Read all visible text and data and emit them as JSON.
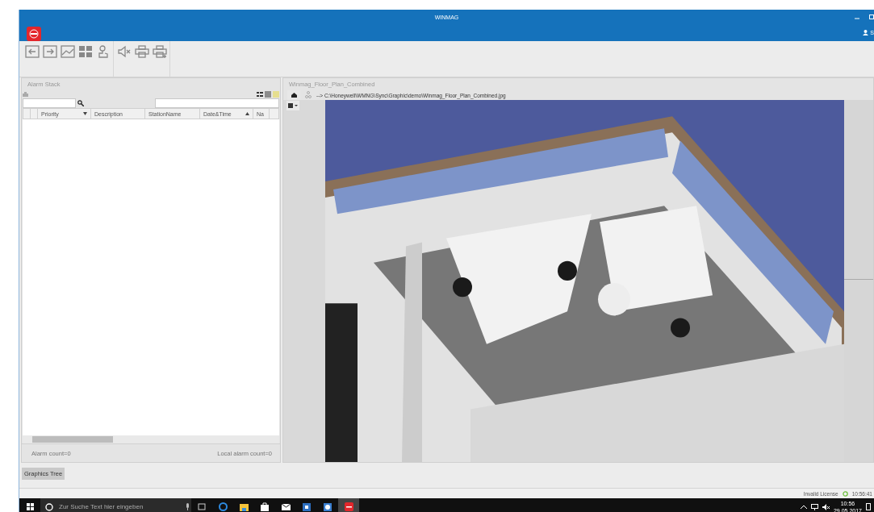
{
  "window": {
    "title": "WINMAG",
    "user": "S"
  },
  "alarm_stack": {
    "title": "Alarm Stack",
    "columns": [
      {
        "label": "Priority",
        "filtered": true,
        "sorted_ascending": false
      },
      {
        "label": "Description",
        "filtered": false,
        "sorted_ascending": false
      },
      {
        "label": "StationName",
        "filtered": false,
        "sorted_ascending": false
      },
      {
        "label": "Date&Time",
        "filtered": false,
        "sorted_ascending": true
      },
      {
        "label": "Na",
        "filtered": false,
        "sorted_ascending": false
      }
    ],
    "alarm_count": "Alarm count=0",
    "local_alarm_count": "Local alarm count=0"
  },
  "graphic": {
    "title": "Winmag_Floor_Plan_Combined",
    "path": "--> C:\\Honeywell\\WMNG\\Sync\\Graphic\\demo\\Winmag_Floor_Plan_Combined.jpg"
  },
  "bottom_tabs": [
    {
      "label": "Graphics Tree",
      "selected": true
    }
  ],
  "status_bar": {
    "license": "Invalid License",
    "time": "10:56:41"
  },
  "taskbar": {
    "search_placeholder": "Zur Suche Text hier eingeben",
    "time": "10:56",
    "date": "29.05.2017"
  }
}
